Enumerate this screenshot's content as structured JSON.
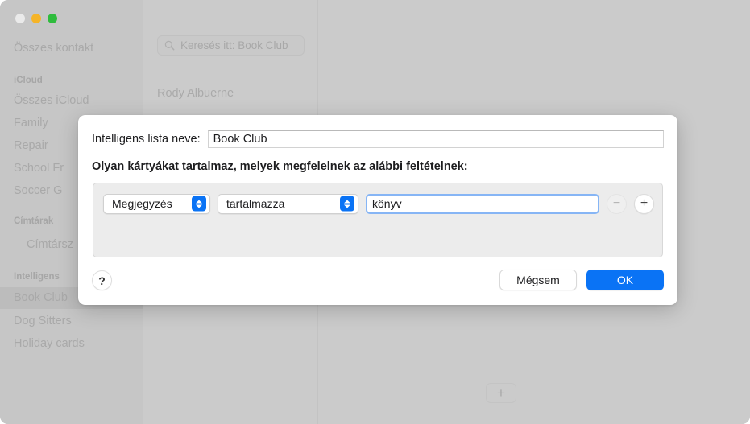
{
  "window": {
    "traffic_lights": [
      "close",
      "minimize",
      "maximize"
    ]
  },
  "sidebar": {
    "all_contacts": "Összes kontakt",
    "groups": [
      {
        "title": "iCloud",
        "items": [
          "Összes iCloud",
          "Family",
          "Repair",
          "School Fr",
          "Soccer G"
        ]
      },
      {
        "title": "Címtárak",
        "items": [
          "Címtársz"
        ]
      },
      {
        "title": "Intelligens",
        "items": [
          "Book Club",
          "Dog Sitters",
          "Holiday cards"
        ]
      }
    ],
    "selected_item": "Book Club"
  },
  "content": {
    "search_placeholder": "Keresés itt: Book Club",
    "search_icon": "search-icon",
    "contacts": [
      "Rody Albuerne"
    ],
    "add_button_label": "+"
  },
  "dialog": {
    "name_label": "Intelligens lista neve:",
    "name_value": "Book Club",
    "criteria_label": "Olyan kártyákat tartalmaz, melyek megfelelnek az alábbi feltételnek:",
    "rules": [
      {
        "attribute": "Megjegyzés",
        "predicate": "tartalmazza",
        "value": "könyv",
        "remove_label": "−",
        "add_label": "+",
        "remove_enabled": false,
        "add_enabled": true
      }
    ],
    "help_label": "?",
    "cancel_label": "Mégsem",
    "ok_label": "OK"
  },
  "colors": {
    "accent": "#0a73f5",
    "window_bg": "#cbcbcb",
    "sidebar_bg": "#c6c6c6",
    "rules_box_bg": "#ececec",
    "focus_ring": "#86b5f5"
  }
}
